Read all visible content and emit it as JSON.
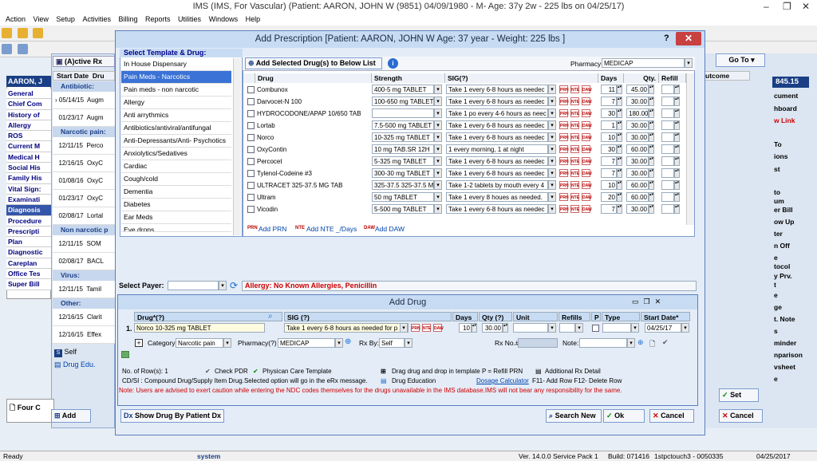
{
  "window": {
    "title": "IMS (IMS, For Vascular)    (Patient: AARON, JOHN W (9851) 04/09/1980 - M- Age: 37y 2w - 225 lbs on 04/25/17)"
  },
  "menu": [
    "Action",
    "View",
    "Setup",
    "Activities",
    "Billing",
    "Reports",
    "Utilities",
    "Windows",
    "Help"
  ],
  "left_nav": {
    "patient": "AARON, J",
    "tab_active_rx": "(A)ctive Rx",
    "items": [
      "General",
      "Chief Com",
      "History of",
      "Allergy",
      "ROS",
      "Current M",
      "Medical H",
      "Social His",
      "Family His",
      "Vital Sign:",
      "Examinati",
      "Diagnosis",
      "Procedure",
      "Prescripti",
      "Plan",
      "Diagnostic",
      "Careplan",
      "Office Tes",
      "Super Bill"
    ],
    "selected": "Diagnosis"
  },
  "background_rx": {
    "headers": [
      "Start Date",
      "Dru"
    ],
    "groups": [
      {
        "label": "Antibiotic:",
        "rows": [
          {
            "date": "05/14/15",
            "drug": "Augm"
          },
          {
            "date": "01/23/17",
            "drug": "Augm"
          }
        ]
      },
      {
        "label": "Narcotic pain:",
        "rows": [
          {
            "date": "12/11/15",
            "drug": "Perco"
          },
          {
            "date": "12/16/15",
            "drug": "OxyC"
          },
          {
            "date": "01/08/16",
            "drug": "OxyC"
          },
          {
            "date": "01/23/17",
            "drug": "OxyC"
          },
          {
            "date": "02/08/17",
            "drug": "Lortal"
          }
        ]
      },
      {
        "label": "Non narcotic p",
        "rows": [
          {
            "date": "12/11/15",
            "drug": "SOM"
          },
          {
            "date": "02/08/17",
            "drug": "BACL"
          }
        ]
      },
      {
        "label": "Virus:",
        "rows": [
          {
            "date": "12/11/15",
            "drug": "Tamil"
          }
        ]
      },
      {
        "label": "Other:",
        "rows": [
          {
            "date": "12/16/15",
            "drug": "Clarit"
          },
          {
            "date": "12/16/15",
            "drug": "Effex"
          }
        ]
      }
    ],
    "self_label": "Self",
    "drug_edu": "Drug Edu.",
    "four_c": "Four C",
    "add_btn": "Add"
  },
  "right_panel": {
    "goto": "Go To",
    "outcome": "utcome",
    "amount": "845.15",
    "items": [
      "cument",
      "hboard",
      "w Link",
      "To",
      "ions",
      "st",
      "to",
      "um",
      "er Bill",
      "ow Up",
      "ter",
      "n Off",
      "e",
      "tocol",
      "y Prv.",
      "t",
      "e",
      "ge",
      "t. Note",
      "s",
      "minder",
      "nparison",
      "vsheet",
      "e"
    ],
    "set_btn": "Set",
    "cancel_btn": "Cancel"
  },
  "dialog": {
    "title": "Add Prescription  [Patient: AARON, JOHN W  Age: 37 year  - Weight: 225 lbs ]",
    "help": "?",
    "close": "✕",
    "template_header": "Select Template & Drug:",
    "templates": [
      "In House Dispensary",
      "Pain Meds - Narcotics",
      "Pain meds - non narcotic",
      "Allergy",
      "Anti arrythmics",
      "Antibiotics/antiviral/antifungal",
      "Anti-Depressants/Anti- Psychotics",
      "Anxiolytics/Sedatives",
      "Cardiac",
      "Cough/cold",
      "Dementia",
      "Diabetes",
      "Ear Meds",
      "Eye drops"
    ],
    "selected_template": "Pain Meds - Narcotics",
    "add_selected_btn": "Add Selected Drug(s) to Below List",
    "pharmacy_label": "Pharmacy:",
    "pharmacy_value": "MEDICAP",
    "grid_headers": [
      "Drug",
      "Strength",
      "SIG(?)",
      "Days",
      "Qty.",
      "Refill"
    ],
    "drugs": [
      {
        "drug": "Combunox",
        "strength": "400-5 mg TABLET",
        "sig": "Take 1 every 6-8 hours as needec",
        "days": "11",
        "qty": "45.00"
      },
      {
        "drug": "Darvocet-N 100",
        "strength": "100-650 mg TABLET",
        "sig": "Take 1 every 6-8 hours as needec",
        "days": "7",
        "qty": "30.00"
      },
      {
        "drug": "HYDROCODONE/APAP 10/650 TAB",
        "strength": "",
        "sig": "Take 1 po every 4-6 hours as neec",
        "days": "30",
        "qty": "180.00"
      },
      {
        "drug": "Lortab",
        "strength": "7.5-500 mg TABLET",
        "sig": "Take 1 every 6-8 hours as needec",
        "days": "1",
        "qty": "30.00"
      },
      {
        "drug": "Norco",
        "strength": "10-325 mg TABLET",
        "sig": "Take 1 every 6-8 hours as needec",
        "days": "10",
        "qty": "30.00"
      },
      {
        "drug": "OxyContin",
        "strength": "10 mg TAB.SR 12H",
        "sig": "1 every morning,  1 at night",
        "days": "30",
        "qty": "60.00"
      },
      {
        "drug": "Percocet",
        "strength": "5-325 mg TABLET",
        "sig": "Take 1 every 6-8 hours as needec",
        "days": "7",
        "qty": "30.00"
      },
      {
        "drug": "Tylenol-Codeine #3",
        "strength": "300-30 mg TABLET",
        "sig": "Take 1 every 6-8 hours as needec",
        "days": "7",
        "qty": "30.00"
      },
      {
        "drug": "ULTRACET  325-37.5 MG  TAB",
        "strength": "325-37.5 325-37.5 M",
        "sig": "Take 1-2 tablets by mouth every 4",
        "days": "10",
        "qty": "60.00"
      },
      {
        "drug": "Ultram",
        "strength": "50 mg TABLET",
        "sig": "Take 1 every 8 houes as needed.",
        "days": "20",
        "qty": "60.00"
      },
      {
        "drug": "Vicodin",
        "strength": "5-500 mg TABLET",
        "sig": "Take 1 every 6-8 hours as needec",
        "days": "7",
        "qty": "30.00"
      }
    ],
    "add_prn": "Add PRN",
    "add_nte": "Add NTE _/Days",
    "add_daw": "Add DAW",
    "payer_label": "Select Payer:",
    "allergy": "Allergy: No Known Allergies, Penicillin"
  },
  "add_drug": {
    "title": "Add Drug",
    "headers": [
      "Drug*(?)",
      "SIG (?)",
      "Days",
      "Qty (?)",
      "Unit",
      "Refills",
      "P",
      "Type",
      "Start Date*"
    ],
    "row_num": "1.",
    "drug": "Norco 10-325 mg TABLET",
    "sig": "Take 1 every 6-8 hours as needed for p",
    "days": "10",
    "qty": "30.00",
    "start_date": "04/25/17",
    "category_label": "Category:",
    "category": "Narcotic pain",
    "pharmacy_label": "Pharmacy(?)",
    "pharmacy": "MEDICAP",
    "rxby_label": "Rx By:",
    "rxby": "Self",
    "rxno_label": "Rx No.#",
    "note_label": "Note:",
    "rows_label": "No. of Row(s): 1",
    "check_pdr": "Check PDR",
    "physician_tpl": "Physican Care Template",
    "drag_hint": "Drag drug and drop in template  P = Refill PRN",
    "additional": "Additional Rx Detail",
    "cd_si": "CD/SI : Compound Drug/Supply Item Drug.Selected option will go in the eRx message.",
    "drug_education": "Drug Education",
    "dosage_calc": "Dosage Calculator",
    "f11": "F11- Add Row  F12- Delete Row",
    "note": "Note: Users are advised to exert caution while entering the NDC codes themselves for the drugs unavailable in the IMS database.IMS will not bear any responsibility for the same."
  },
  "buttons": {
    "show_by_patient": "Show Drug By Patient Dx",
    "search_new": "Search New",
    "ok": "Ok",
    "cancel": "Cancel"
  },
  "status": {
    "ready": "Ready",
    "user": "system",
    "version": "Ver. 14.0.0 Service Pack 1",
    "build": "Build: 071416",
    "host": "1stpctouch3 - 0050335",
    "date": "04/25/2017"
  },
  "colors": {
    "title_accent": "#c7dcf3",
    "allergy_red": "#cc0000",
    "selection": "#3a72d6"
  }
}
